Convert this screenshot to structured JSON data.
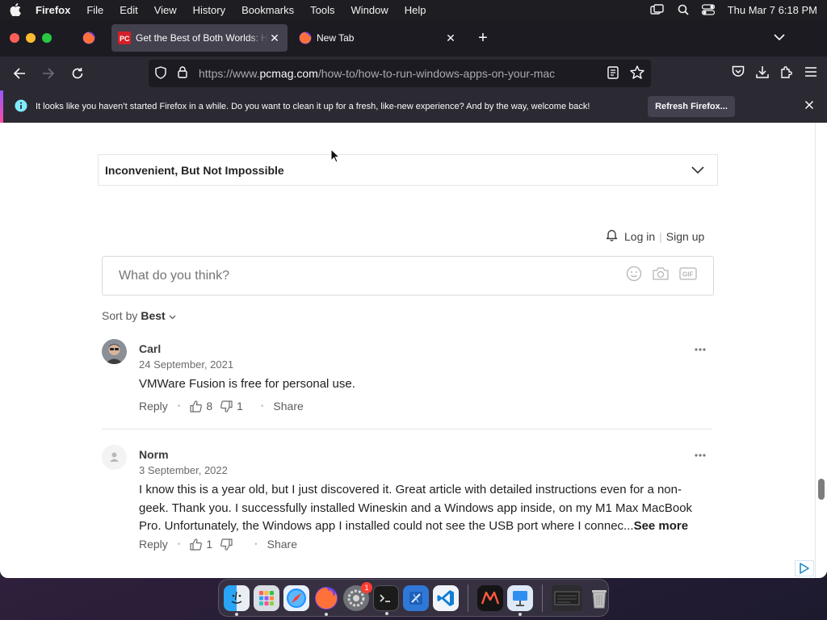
{
  "menubar": {
    "app_name": "Firefox",
    "items": [
      "File",
      "Edit",
      "View",
      "History",
      "Bookmarks",
      "Tools",
      "Window",
      "Help"
    ],
    "clock": "Thu Mar 7  6:18 PM"
  },
  "tabs": {
    "active_title": "Get the Best of Both Worlds: How to Run Windows Apps on Your Mac",
    "second_title": "New Tab"
  },
  "urlbar": {
    "prefix": "https://www.",
    "domain": "pcmag.com",
    "path": "/how-to/how-to-run-windows-apps-on-your-mac"
  },
  "notification": {
    "message": "It looks like you haven’t started Firefox in a while. Do you want to clean it up for a fresh, like-new experience? And by the way, welcome back!",
    "button": "Refresh Firefox..."
  },
  "article": {
    "accordion_title": "Inconvenient, But Not Impossible"
  },
  "comments_widget": {
    "login": "Log in",
    "signup": "Sign up",
    "placeholder": "What do you think?",
    "sort_label": "Sort by",
    "sort_value": "Best",
    "reply_label": "Reply",
    "share_label": "Share",
    "see_more": "See more",
    "comments": [
      {
        "author": "Carl",
        "date": "24 September, 2021",
        "text": "VMWare Fusion is free for personal use.",
        "upvotes": "8",
        "downvotes": "1"
      },
      {
        "author": "Norm",
        "date": "3 September, 2022",
        "text": "I know this is a year old, but I just discovered it. Great article with detailed instructions even for a non-geek.  Thank you.  I successfully installed Wineskin and a Windows app inside, on my M1 Max MacBook Pro.  Unfortunately, the Windows app I installed could not see the USB port where I connec...",
        "upvotes": "1",
        "downvotes": ""
      }
    ]
  },
  "dock": {
    "settings_badge": "1"
  },
  "colors": {
    "chrome_dark": "#1c1b22",
    "toolbar": "#2b2a33",
    "active_tab": "#42414d",
    "pcmag_red": "#d41f27"
  }
}
